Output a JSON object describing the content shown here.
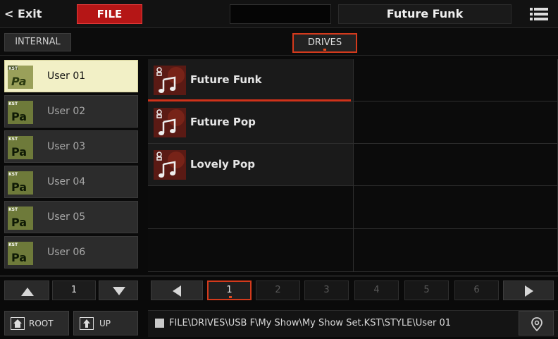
{
  "topbar": {
    "exit_label": "< Exit",
    "file_label": "FILE",
    "title": "Future Funk",
    "menu_icon": "hamburger-list-icon"
  },
  "tabs": {
    "internal_label": "INTERNAL",
    "drives_label": "DRIVES"
  },
  "folders": [
    {
      "label": "User 01",
      "selected": true,
      "icon": "kst-pa-folder-icon"
    },
    {
      "label": "User 02",
      "selected": false,
      "icon": "kst-pa-folder-icon"
    },
    {
      "label": "User 03",
      "selected": false,
      "icon": "kst-pa-folder-icon"
    },
    {
      "label": "User 04",
      "selected": false,
      "icon": "kst-pa-folder-icon"
    },
    {
      "label": "User 05",
      "selected": false,
      "icon": "kst-pa-folder-icon"
    },
    {
      "label": "User 06",
      "selected": false,
      "icon": "kst-pa-folder-icon"
    }
  ],
  "folder_pager": {
    "page": "1"
  },
  "files": [
    {
      "label": "Future Funk",
      "selected": true,
      "icon": "style-music-icon"
    },
    {
      "label": "Future Pop",
      "selected": false,
      "icon": "style-music-icon"
    },
    {
      "label": "Lovely Pop",
      "selected": false,
      "icon": "style-music-icon"
    }
  ],
  "pages": [
    "1",
    "2",
    "3",
    "4",
    "5",
    "6"
  ],
  "current_page": "1",
  "bottom": {
    "root_label": "ROOT",
    "up_label": "UP",
    "path": "FILE\\DRIVES\\USB F\\My Show\\My Show Set.KST\\STYLE\\User 01",
    "location_icon": "location-pin-icon"
  },
  "colors": {
    "accent_red": "#b51616",
    "selection_outline": "#d33a1c",
    "selected_folder_bg": "#f2f0c6"
  }
}
